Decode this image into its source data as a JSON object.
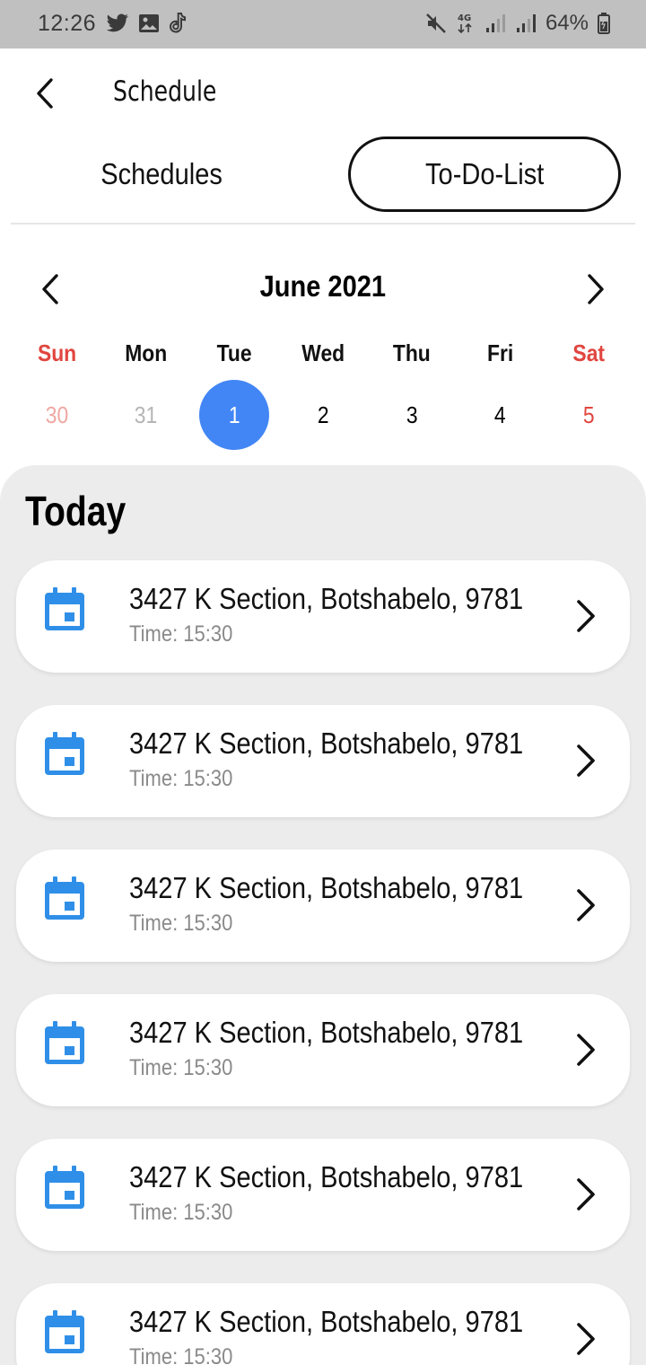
{
  "status_bar": {
    "time": "12:26",
    "left_icons": [
      "twitter-icon",
      "image-icon",
      "tiktok-icon"
    ],
    "right_icons": [
      "mute-icon",
      "network-4g-icon",
      "signal-icon",
      "signal-icon",
      "battery-icon"
    ],
    "battery_percent": "64%"
  },
  "header": {
    "back_icon": "back-arrow-icon",
    "title": "Schedule"
  },
  "tabs": [
    {
      "label": "Schedules",
      "active": false
    },
    {
      "label": "To-Do-List",
      "active": true
    }
  ],
  "calendar": {
    "month_label": "June 2021",
    "weekdays": [
      "Sun",
      "Mon",
      "Tue",
      "Wed",
      "Thu",
      "Fri",
      "Sat"
    ],
    "days": [
      "30",
      "31",
      "1",
      "2",
      "3",
      "4",
      "5"
    ],
    "selected_day": "1",
    "colors": {
      "weekend": "#e0463f",
      "selected": "#4286f5",
      "muted": "#b5b5b5"
    }
  },
  "today": {
    "title": "Today",
    "items": [
      {
        "address": "3427 K Section, Botshabelo, 9781",
        "time": "Time: 15:30",
        "icon": "calendar-icon"
      },
      {
        "address": "3427 K Section, Botshabelo, 9781",
        "time": "Time: 15:30",
        "icon": "calendar-icon"
      },
      {
        "address": "3427 K Section, Botshabelo, 9781",
        "time": "Time: 15:30",
        "icon": "calendar-icon"
      },
      {
        "address": "3427 K Section, Botshabelo, 9781",
        "time": "Time: 15:30",
        "icon": "calendar-icon"
      },
      {
        "address": "3427 K Section, Botshabelo, 9781",
        "time": "Time: 15:30",
        "icon": "calendar-icon"
      },
      {
        "address": "3427 K Section, Botshabelo, 9781",
        "time": "Time: 15:30",
        "icon": "calendar-icon"
      }
    ],
    "colors": {
      "icon": "#2f8fe8",
      "panel": "#ececec"
    }
  }
}
